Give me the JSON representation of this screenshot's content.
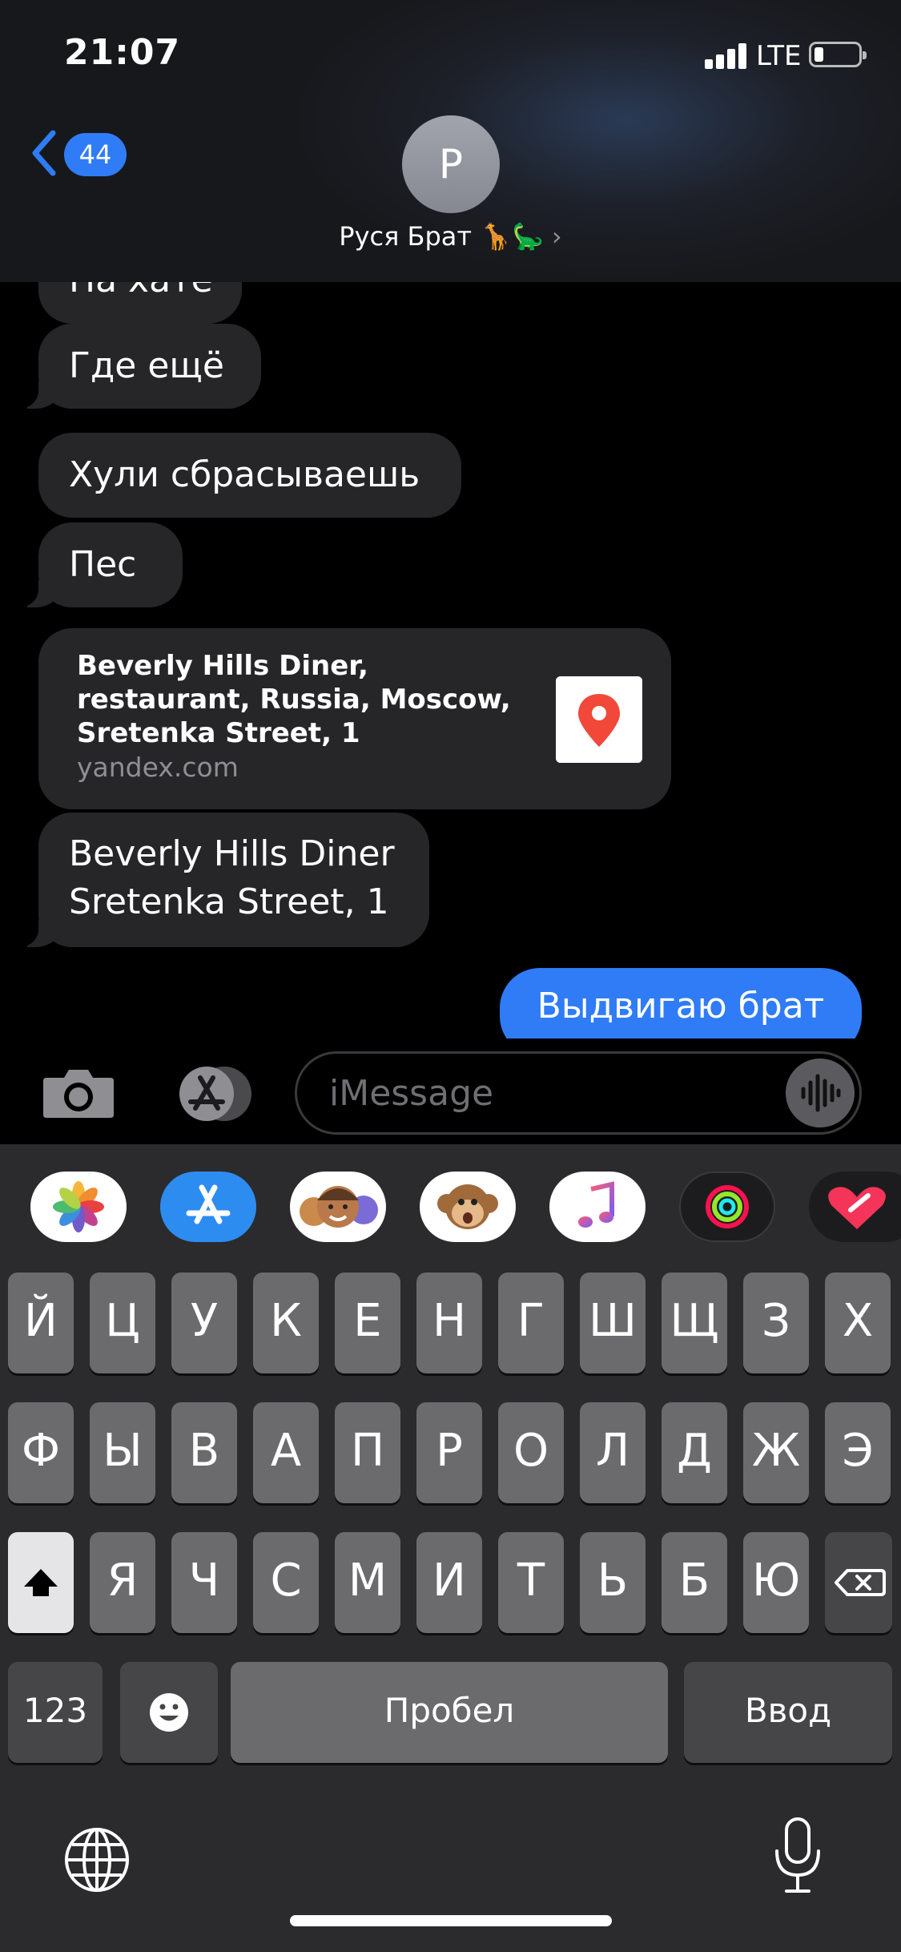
{
  "status_bar": {
    "time": "21:07",
    "network": "LTE",
    "battery_level": 0.22
  },
  "header": {
    "back_count": "44",
    "avatar_initial": "P",
    "contact_name": "Руся Брат 🦒🦕",
    "chevron": "›"
  },
  "messages": {
    "m0": "На хате",
    "m1": "Где ещё",
    "m2": "Хули сбрасываешь",
    "m3": "Пес",
    "link_card": {
      "title": "Beverly Hills Diner, restaurant, Russia, Moscow, Sretenka Street, 1",
      "domain": "yandex.com",
      "icon": "yandex-maps-pin-icon"
    },
    "m5_line1": "Beverly Hills Diner",
    "m5_line2": "Sretenka Street, 1",
    "sent": "Выдвигаю брат"
  },
  "input": {
    "placeholder": "iMessage"
  },
  "app_strip": [
    "Photos",
    "App Store",
    "Memoji Stickers",
    "Animoji",
    "Music",
    "Activity",
    "Heart"
  ],
  "keyboard": {
    "row1": [
      "Й",
      "Ц",
      "У",
      "К",
      "Е",
      "Н",
      "Г",
      "Ш",
      "Щ",
      "З",
      "Х"
    ],
    "row2": [
      "Ф",
      "Ы",
      "В",
      "А",
      "П",
      "Р",
      "О",
      "Л",
      "Д",
      "Ж",
      "Э"
    ],
    "row3": [
      "Я",
      "Ч",
      "С",
      "М",
      "И",
      "Т",
      "Ь",
      "Б",
      "Ю"
    ],
    "numbers": "123",
    "space": "Пробел",
    "return": "Ввод"
  },
  "colors": {
    "accent": "#2f7cf6",
    "bubble_received": "#262629",
    "keyboard_bg": "#2b2b2d",
    "key": "#6b6b6e"
  }
}
